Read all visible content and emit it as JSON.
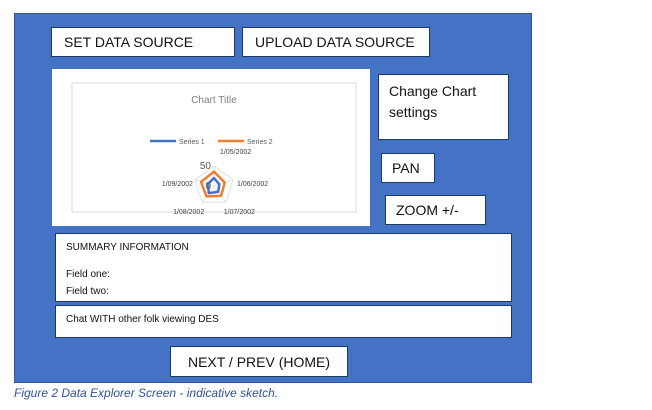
{
  "toolbar": {
    "set_data_source": "SET DATA SOURCE",
    "upload_data_source": "UPLOAD DATA SOURCE"
  },
  "side": {
    "change_chart_settings": "Change Chart settings",
    "pan": "PAN",
    "zoom": "ZOOM +/-"
  },
  "summary": {
    "title": "SUMMARY INFORMATION",
    "field_one": "Field one:",
    "field_two": "Field two:"
  },
  "chat": {
    "label": "Chat WITH other folk viewing DES"
  },
  "nav": {
    "label": "NEXT / PREV (HOME)"
  },
  "caption": "Figure 2 Data Explorer Screen - indicative sketch.",
  "colors": {
    "frame": "#4472c4",
    "series1": "#4472c4",
    "series2": "#ed7d31"
  },
  "chart_data": {
    "type": "radar",
    "title": "Chart Title",
    "categories": [
      "1/05/2002",
      "1/06/2002",
      "1/07/2002",
      "1/08/2002",
      "1/09/2002"
    ],
    "radial_ticks": [
      0,
      50
    ],
    "series": [
      {
        "name": "Series 1",
        "values": [
          20,
          14,
          18,
          22,
          16
        ]
      },
      {
        "name": "Series 2",
        "values": [
          36,
          28,
          30,
          32,
          34
        ]
      }
    ],
    "legend": "top"
  }
}
